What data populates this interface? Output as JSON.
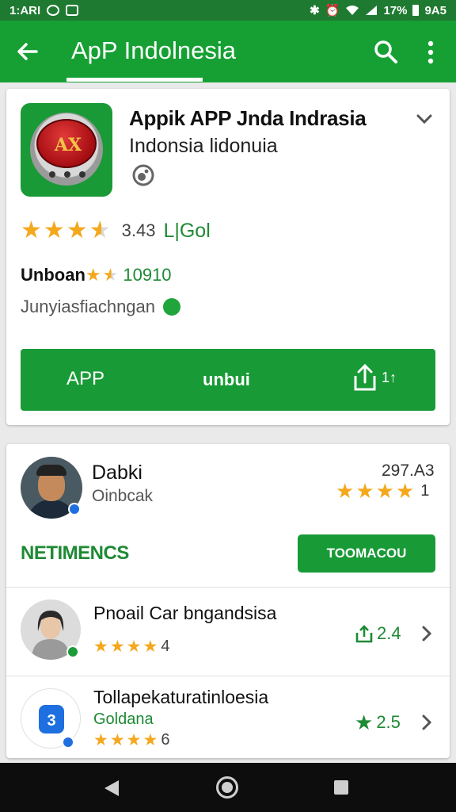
{
  "status_bar": {
    "carrier": "1:ARI",
    "battery": "17%",
    "time": "9A5"
  },
  "app_bar": {
    "title": "ApP Indolnesia"
  },
  "app": {
    "title": "Appik APP Jnda Indrasia",
    "subtitle": "Indonsia lidonuia",
    "icon_text": "AX",
    "rating_value": "3.43",
    "rating_stars": 3.5,
    "rating_count": "L|Gol",
    "unbo_label": "Unboan",
    "unbo_stars": 1.5,
    "unbo_value": "10910",
    "category": "Junyiasfiachngan",
    "actions": {
      "primary": "APP",
      "secondary": "unbui",
      "share_count": "1↑"
    }
  },
  "top_review": {
    "name": "Dabki",
    "subtitle": "Oinbcak",
    "score": "297.A3",
    "stars": 4,
    "count": "1"
  },
  "section": {
    "title": "NETIMENCS",
    "button_label": "TOOMACOU"
  },
  "items": [
    {
      "title": "Pnoail Car bngandsisa",
      "subtitle": "",
      "stars": 4,
      "count": "4",
      "metric": "2.4",
      "metric_icon": "share-icon"
    },
    {
      "title": "Tollapekaturatinloesia",
      "subtitle": "Goldana",
      "stars": 4,
      "count": "6",
      "metric": "2.5",
      "metric_icon": "star-icon"
    }
  ],
  "colors": {
    "primary_green": "#16a033",
    "status_green": "#1f7a31",
    "star": "#f4a81d",
    "accent_blue": "#1e6fe0"
  }
}
